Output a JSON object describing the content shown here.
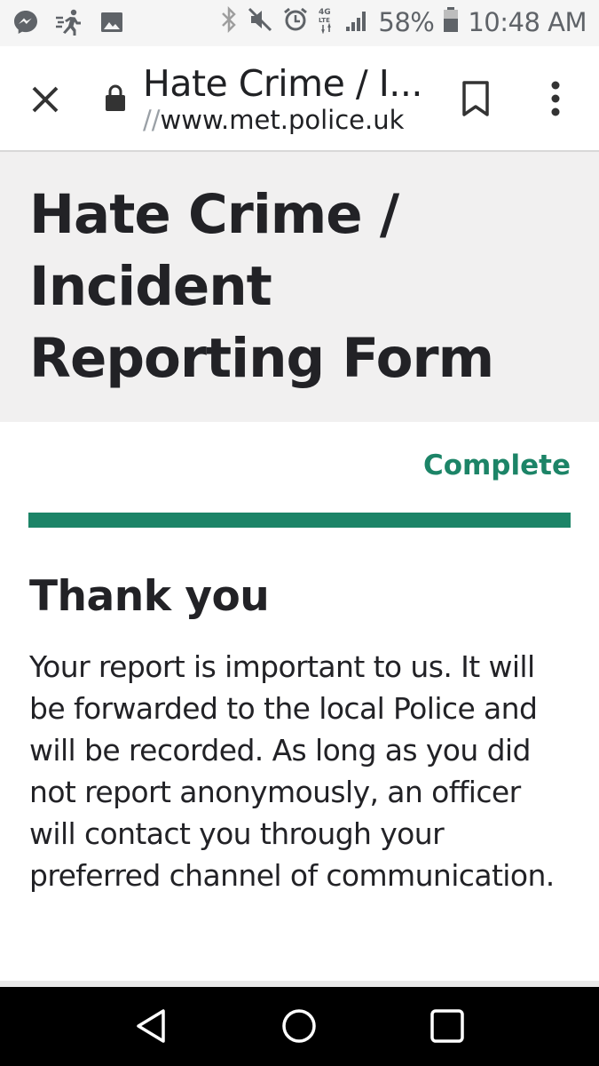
{
  "status_bar": {
    "battery": "58%",
    "time": "10:48 AM",
    "network": "4G LTE",
    "icons": [
      "messenger-icon",
      "activity-icon",
      "image-icon",
      "bluetooth-icon",
      "mute-icon",
      "alarm-icon",
      "network-type-icon",
      "signal-icon",
      "battery-icon"
    ]
  },
  "browser": {
    "page_title": "Hate Crime / I...",
    "url_prefix": "//",
    "url_host": "www.met.police.uk",
    "icons": [
      "close-icon",
      "lock-icon",
      "bookmark-icon",
      "more-options-icon"
    ]
  },
  "header": {
    "title": "Hate Crime / Incident Reporting Form"
  },
  "progress": {
    "label": "Complete",
    "fraction": 1.0,
    "color": "#1c8467"
  },
  "confirmation": {
    "heading": "Thank you",
    "body": "Your report is important to us. It will be forwarded to the local Police and will be recorded. As long as you did not report anonymously, an officer will contact you through your preferred channel of communication."
  },
  "nav_bar": {
    "icons": [
      "back-icon",
      "home-icon",
      "recents-icon"
    ]
  }
}
